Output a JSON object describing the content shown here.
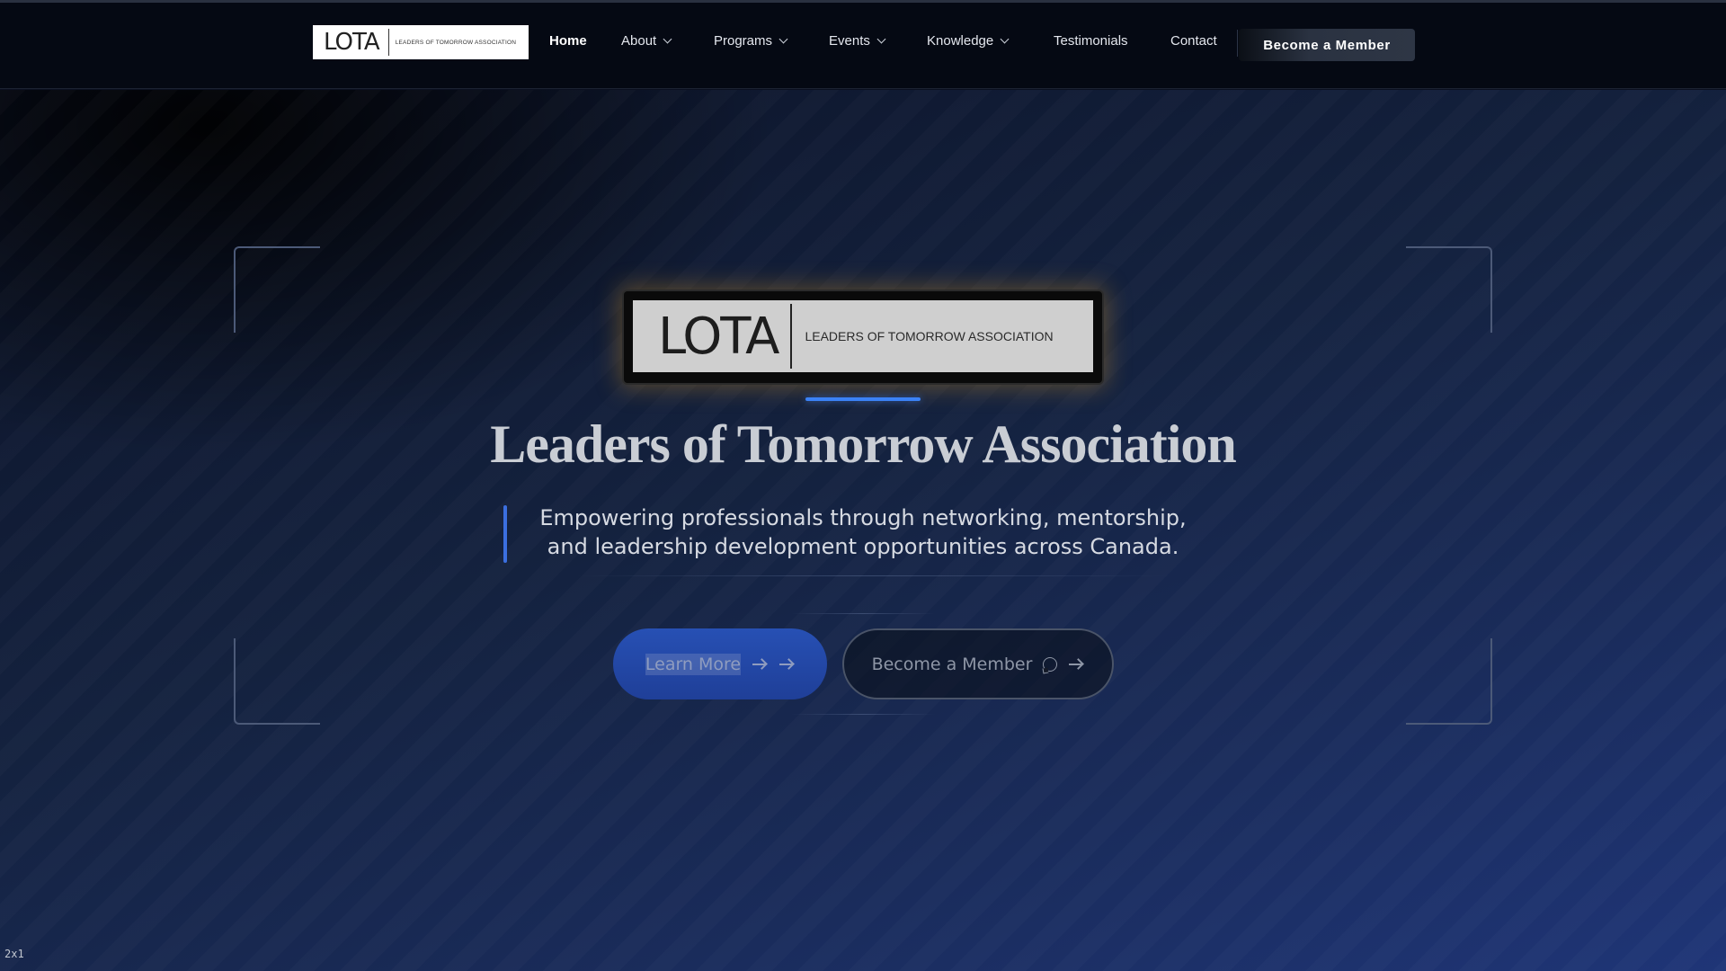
{
  "nav": {
    "logo": {
      "wordmark": "LOTA",
      "tagline": "LEADERS OF TOMORROW ASSOCIATION"
    },
    "items": [
      {
        "label": "Home",
        "active": true,
        "dropdown": false
      },
      {
        "label": "About",
        "dropdown": true
      },
      {
        "label": "Programs",
        "dropdown": true
      },
      {
        "label": "Events",
        "dropdown": true
      },
      {
        "label": "Knowledge",
        "dropdown": true
      },
      {
        "label": "Testimonials",
        "dropdown": false
      },
      {
        "label": "Contact",
        "dropdown": false
      }
    ],
    "cta_label": "Become a Member"
  },
  "hero": {
    "logo": {
      "wordmark": "LOTA",
      "tagline": "LEADERS OF TOMORROW ASSOCIATION"
    },
    "title": "Leaders of Tomorrow Association",
    "subtitle": "Empowering professionals through networking, mentorship, and leadership development opportunities across Canada.",
    "learn_more_label": "Learn More",
    "become_member_label": "Become a Member"
  },
  "corner_label": "2x1",
  "colors": {
    "accent": "#3b82f6",
    "nav_bg": "#050913",
    "hero_gradient_end": "#1f3577",
    "logo_glow": "#c88c1e"
  },
  "icons": [
    "chevron-down-icon",
    "arrow-right-icon",
    "chat-bubble-icon"
  ]
}
